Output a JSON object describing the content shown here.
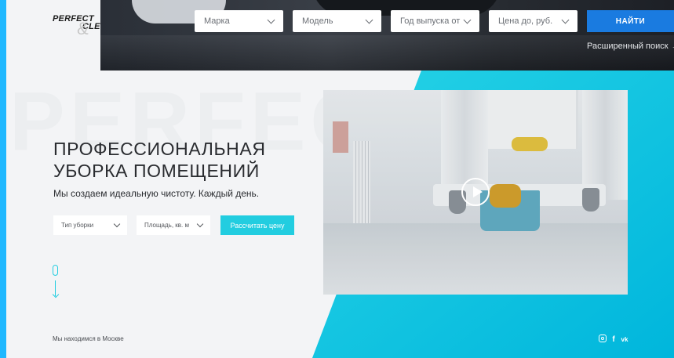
{
  "brand": {
    "line1": "PERFECT",
    "line2": "CLE",
    "ampersand": "&"
  },
  "watermark": "PERFECT",
  "search": {
    "make": "Марка",
    "model": "Модель",
    "year_from": "Год выпуска от",
    "price_to": "Цена до, руб.",
    "find_button": "НАЙТИ",
    "advanced_link": "Расширенный поиск",
    "advanced_arrow": "→"
  },
  "hero": {
    "title_line1": "ПРОФЕССИОНАЛЬНАЯ",
    "title_line2": "УБОРКА ПОМЕЩЕНИЙ",
    "subtitle": "Мы создаем идеальную чистоту. Каждый день."
  },
  "form": {
    "cleaning_type": "Тип уборки",
    "area": "Площадь, кв. м",
    "calc_button": "Рассчитать цену"
  },
  "footer": {
    "location": "Мы находимся в Москве",
    "social": {
      "facebook": "f",
      "vk": "vk"
    }
  },
  "icons": {
    "video": "play-icon",
    "scroll": "mouse-scroll-icon",
    "instagram": "instagram-icon",
    "facebook": "facebook-icon",
    "vk": "vk-icon"
  },
  "colors": {
    "accent": "#22cde0",
    "button_blue": "#1a7be0",
    "text_dark": "#2a2c30"
  }
}
